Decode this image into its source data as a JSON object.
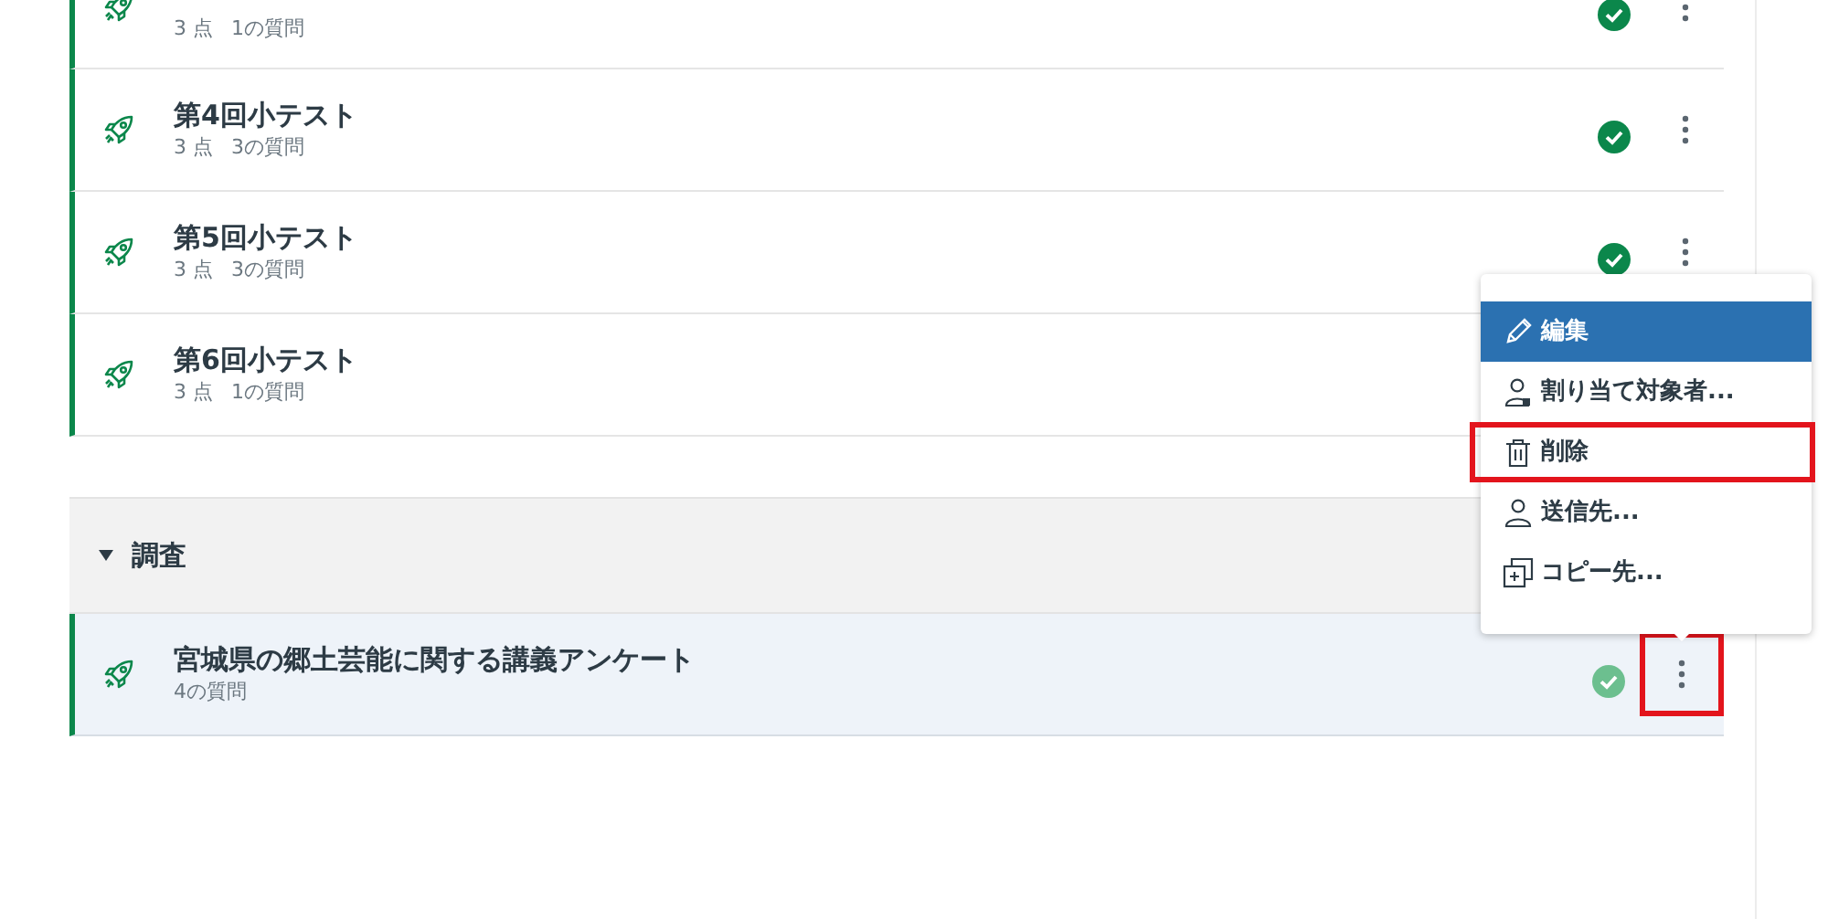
{
  "quizzes": [
    {
      "points": "3 点",
      "questions": "1の質問",
      "published": true
    },
    {
      "title": "第4回小テスト",
      "points": "3 点",
      "questions": "3の質問",
      "published": true
    },
    {
      "title": "第5回小テスト",
      "points": "3 点",
      "questions": "3の質問",
      "published": true
    },
    {
      "title": "第6回小テスト",
      "points": "3 点",
      "questions": "1の質問"
    }
  ],
  "section": {
    "title": "調査",
    "expanded": true,
    "items": [
      {
        "title": "宮城県の郷土芸能に関する講義アンケート",
        "questions": "4の質問",
        "published": true,
        "selected": true,
        "menu_highlighted": true
      }
    ]
  },
  "menu": {
    "items": [
      {
        "kind": "edit",
        "label": "編集",
        "selected": true,
        "highlighted": false
      },
      {
        "kind": "assign",
        "label": "割り当て対象者...",
        "selected": false,
        "highlighted": false
      },
      {
        "kind": "delete",
        "label": "削除",
        "selected": false,
        "highlighted": true
      },
      {
        "kind": "send",
        "label": "送信先...",
        "selected": false,
        "highlighted": false
      },
      {
        "kind": "copy",
        "label": "コピー先...",
        "selected": false,
        "highlighted": false
      }
    ]
  }
}
